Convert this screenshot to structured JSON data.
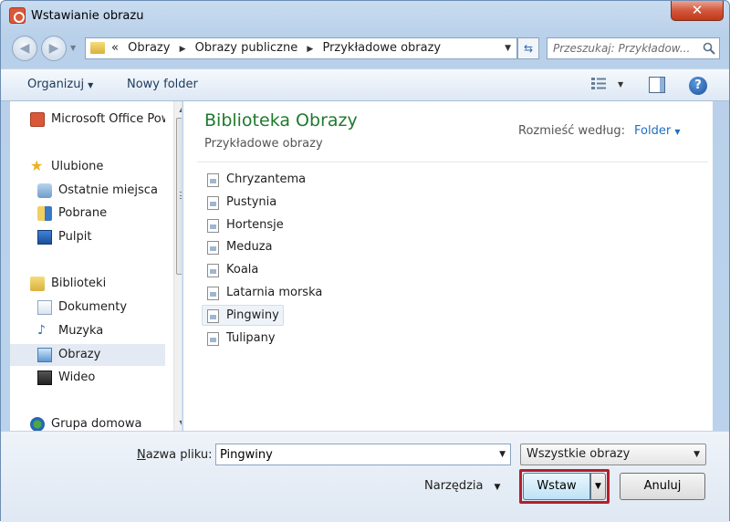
{
  "window": {
    "title": "Wstawianie obrazu",
    "close_label": "✕"
  },
  "address": {
    "overflow": "«",
    "crumbs": [
      "Obrazy",
      "Obrazy publiczne",
      "Przykładowe obrazy"
    ]
  },
  "search": {
    "placeholder": "Przeszukaj: Przykładow..."
  },
  "toolbar": {
    "organize_label": "Organizuj",
    "new_folder_label": "Nowy folder",
    "help_label": "?"
  },
  "navigation": {
    "items": [
      {
        "label": "Microsoft Office PowerPoint",
        "icon": "office-app-icon",
        "indent": 0,
        "selected": false
      },
      {
        "label": "Ulubione",
        "icon": "star-icon",
        "indent": 0,
        "selected": false
      },
      {
        "label": "Ostatnie miejsca",
        "icon": "recent-places-icon",
        "indent": 1,
        "selected": false
      },
      {
        "label": "Pobrane",
        "icon": "downloads-icon",
        "indent": 1,
        "selected": false
      },
      {
        "label": "Pulpit",
        "icon": "desktop-icon",
        "indent": 1,
        "selected": false
      },
      {
        "label": "Biblioteki",
        "icon": "libraries-icon",
        "indent": 0,
        "selected": false
      },
      {
        "label": "Dokumenty",
        "icon": "documents-icon",
        "indent": 1,
        "selected": false
      },
      {
        "label": "Muzyka",
        "icon": "music-icon",
        "indent": 1,
        "selected": false
      },
      {
        "label": "Obrazy",
        "icon": "pictures-icon",
        "indent": 1,
        "selected": true
      },
      {
        "label": "Wideo",
        "icon": "video-icon",
        "indent": 1,
        "selected": false
      },
      {
        "label": "Grupa domowa",
        "icon": "homegroup-icon",
        "indent": 0,
        "selected": false
      }
    ]
  },
  "content": {
    "title": "Biblioteka Obrazy",
    "subtitle": "Przykładowe obrazy",
    "arrange_label": "Rozmieść według:",
    "arrange_value": "Folder",
    "files": [
      {
        "name": "Chryzantema",
        "selected": false
      },
      {
        "name": "Pustynia",
        "selected": false
      },
      {
        "name": "Hortensje",
        "selected": false
      },
      {
        "name": "Meduza",
        "selected": false
      },
      {
        "name": "Koala",
        "selected": false
      },
      {
        "name": "Latarnia morska",
        "selected": false
      },
      {
        "name": "Pingwiny",
        "selected": true
      },
      {
        "name": "Tulipany",
        "selected": false
      }
    ]
  },
  "footer": {
    "filename_label_accel": "N",
    "filename_label_rest": "azwa pliku:",
    "filename_value": "Pingwiny",
    "filter_value": "Wszystkie obrazy",
    "tools_label": "Narzędzia",
    "insert_label": "Wstaw",
    "cancel_label": "Anuluj"
  },
  "colors": {
    "accent_border": "#b61e2a",
    "library_title": "#1e7a2c",
    "link": "#1e6fc2"
  }
}
